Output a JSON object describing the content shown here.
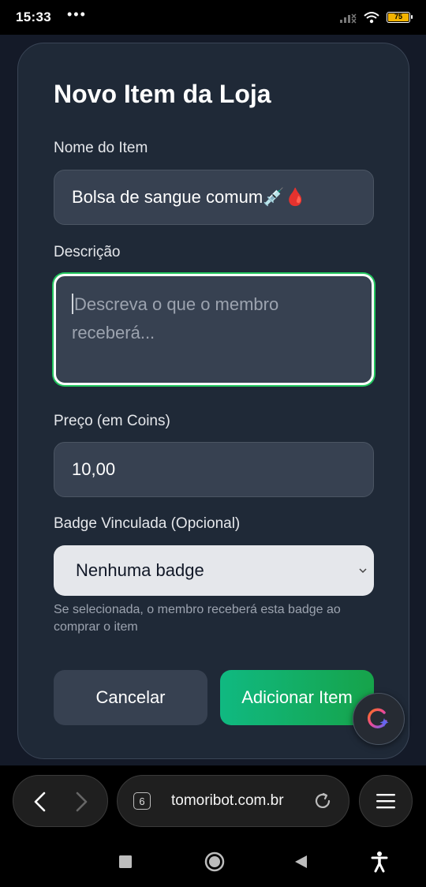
{
  "status_bar": {
    "time": "15:33",
    "more": "•••",
    "battery": "75"
  },
  "modal": {
    "title": "Novo Item da Loja",
    "name_label": "Nome do Item",
    "name_value": "Bolsa de sangue comum💉🩸",
    "description_label": "Descrição",
    "description_placeholder": "Descreva o que o membro receberá...",
    "price_label": "Preço (em Coins)",
    "price_value": "10,00",
    "badge_label": "Badge Vinculada (Opcional)",
    "badge_selected": "Nenhuma badge",
    "badge_hint": "Se selecionada, o membro receberá esta badge ao comprar o item",
    "cancel_label": "Cancelar",
    "add_label": "Adicionar Item"
  },
  "browser": {
    "tab_count": "6",
    "url": "tomoribot.com.br"
  },
  "colors": {
    "modal_bg": "#1f2937",
    "input_bg": "#374151",
    "accent_green": "#10b981",
    "page_bg": "#141a28"
  }
}
